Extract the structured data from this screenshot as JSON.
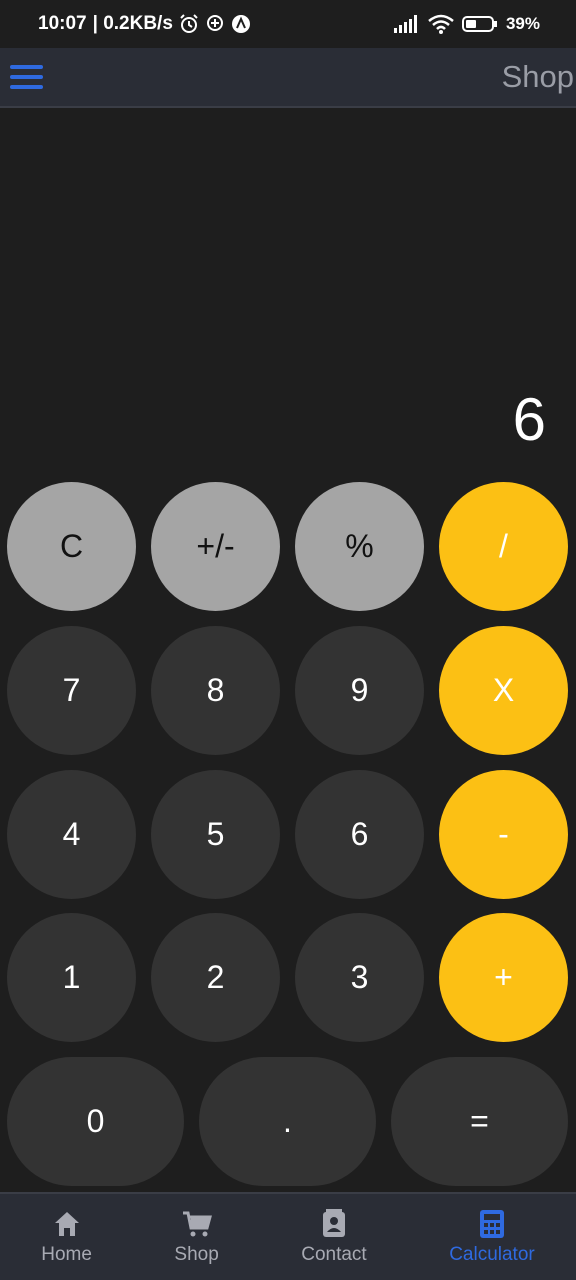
{
  "status_bar": {
    "time": "10:07",
    "network_speed": "| 0.2KB/s",
    "battery": "39%",
    "icons": [
      "alarm-icon",
      "location-icon",
      "app-icon",
      "signal-icon",
      "wifi-icon",
      "battery-icon"
    ]
  },
  "app_bar": {
    "title": "Shop",
    "menu_icon": "menu-icon"
  },
  "display": {
    "value": "6"
  },
  "keypad": {
    "clear": "C",
    "sign": "+/-",
    "percent": "%",
    "divide": "/",
    "seven": "7",
    "eight": "8",
    "nine": "9",
    "multiply": "X",
    "four": "4",
    "five": "5",
    "six": "6",
    "minus": "-",
    "one": "1",
    "two": "2",
    "three": "3",
    "plus": "+",
    "zero": "0",
    "dot": ".",
    "equals": "="
  },
  "bottom_nav": {
    "items": [
      {
        "label": "Home",
        "icon": "home-icon",
        "active": false
      },
      {
        "label": "Shop",
        "icon": "cart-icon",
        "active": false
      },
      {
        "label": "Contact",
        "icon": "contact-icon",
        "active": false
      },
      {
        "label": "Calculator",
        "icon": "calculator-icon",
        "active": true
      }
    ]
  },
  "colors": {
    "background": "#1e1e1e",
    "bar": "#2a2d36",
    "accent": "#2f6ae0",
    "operator": "#fcc014",
    "function_key": "#a5a5a5",
    "number_key": "#333333"
  }
}
